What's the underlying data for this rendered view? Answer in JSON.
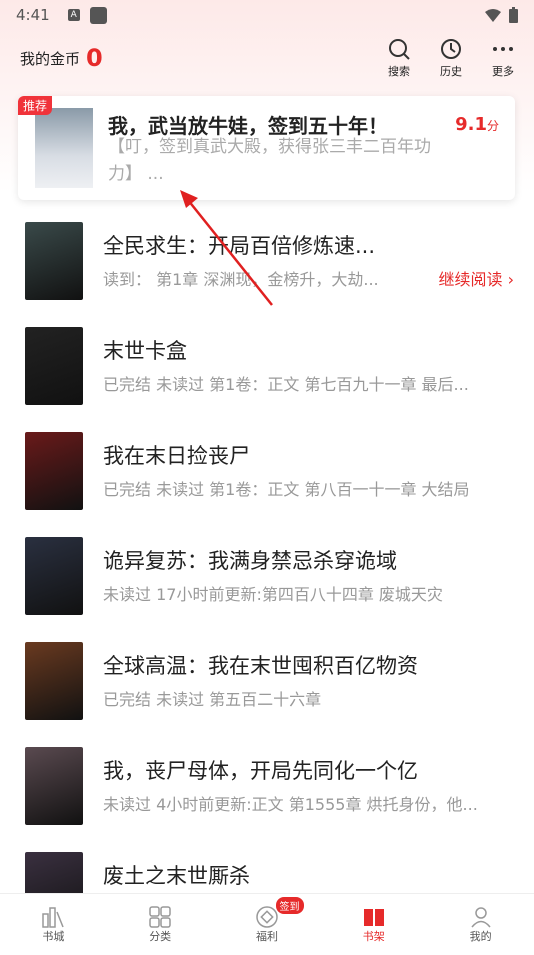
{
  "status": {
    "time": "4:41",
    "badge": "A"
  },
  "header": {
    "coins_label": "我的金币",
    "coins_value": "0",
    "tools": [
      {
        "label": "搜索",
        "icon": "search-icon"
      },
      {
        "label": "历史",
        "icon": "clock-icon"
      },
      {
        "label": "更多",
        "icon": "more-icon"
      }
    ]
  },
  "recommend": {
    "tag": "推荐",
    "title": "我，武当放牛娃，签到五十年！",
    "score": "9.1",
    "score_unit": "分",
    "desc": "【叮，签到真武大殿，获得张三丰二百年功力】 ..."
  },
  "books": [
    {
      "title": "全民求生：开局百倍修炼速...",
      "sub": "读到： 第1章 深渊现，金榜升，大劫...",
      "action": "继续阅读 ›",
      "color": "#3a4a4a"
    },
    {
      "title": "末世卡盒",
      "sub": "已完结 未读过 第1卷：正文 第七百九十一章 最后...",
      "color": "#222"
    },
    {
      "title": "我在末日捡丧尸",
      "sub": "已完结 未读过 第1卷：正文 第八百一十一章 大结局",
      "color": "#6a1a1a"
    },
    {
      "title": "诡异复苏：我满身禁忌杀穿诡域",
      "sub": "未读过 17小时前更新:第四百八十四章 废城天灾",
      "color": "#2a3040"
    },
    {
      "title": "全球高温：我在末世囤积百亿物资",
      "sub": "已完结 未读过 第五百二十六章",
      "color": "#6a3a20"
    },
    {
      "title": "我，丧尸母体，开局先同化一个亿",
      "sub": "未读过 4小时前更新:正文 第1555章 烘托身份，他...",
      "color": "#5a4a50"
    },
    {
      "title": "废土之末世厮杀",
      "sub": "",
      "color": "#3a3040"
    }
  ],
  "nav": [
    {
      "label": "书城",
      "icon": "bookstore-icon"
    },
    {
      "label": "分类",
      "icon": "category-icon"
    },
    {
      "label": "福利",
      "icon": "welfare-icon",
      "badge": "签到"
    },
    {
      "label": "书架",
      "icon": "bookshelf-icon",
      "active": true
    },
    {
      "label": "我的",
      "icon": "profile-icon"
    }
  ],
  "colors": {
    "accent": "#e62a2a"
  }
}
